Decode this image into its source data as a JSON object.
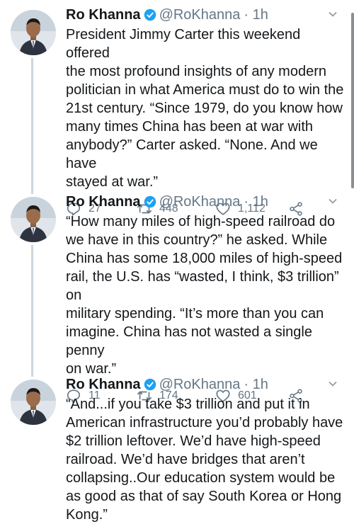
{
  "tweets": [
    {
      "name": "Ro Khanna",
      "handle": "@RoKhanna",
      "time": "· 1h",
      "text": "President Jimmy Carter this weekend offered\nthe most profound insights of any modern\npolitician in what America must do to win the\n21st century. “Since 1979, do you know how\nmany times China has been at war with\nanybody?” Carter asked. “None. And we have\nstayed at war.”",
      "replies": "27",
      "retweets": "448",
      "likes": "1,112"
    },
    {
      "name": "Ro Khanna",
      "handle": "@RoKhanna",
      "time": "· 1h",
      "text": "“How many miles of high-speed railroad do\nwe have in this country?” he asked. While\nChina has some 18,000 miles of high-speed\nrail, the U.S. has “wasted, I think, $3 trillion” on\nmilitary spending. “It’s more than you can\nimagine. China has not wasted a single penny\non war.”",
      "replies": "11",
      "retweets": "174",
      "likes": "601"
    },
    {
      "name": "Ro Khanna",
      "handle": "@RoKhanna",
      "time": "· 1h",
      "text": "“And...if you take $3 trillion and put it in\nAmerican infrastructure you’d probably have\n$2 trillion leftover. We’d have high-speed\nrailroad. We’d have bridges that aren’t\ncollapsing..Our education system would be\nas good as that of say South Korea or Hong\nKong.”"
    }
  ],
  "icons": {
    "verified": "verified-badge-icon",
    "reply": "reply-icon",
    "retweet": "retweet-icon",
    "like": "heart-icon",
    "share": "share-icon",
    "menu": "chevron-down-icon"
  },
  "colors": {
    "verified": "#1da1f2",
    "meta": "#657786",
    "thread_line": "#ccd6dd"
  }
}
